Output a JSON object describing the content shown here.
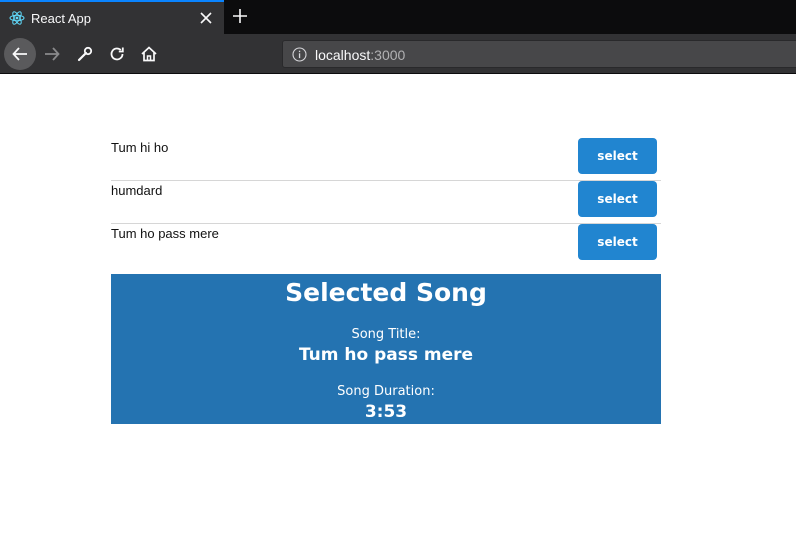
{
  "browser": {
    "tab_title": "React App",
    "url_host": "localhost",
    "url_port": ":3000"
  },
  "songs": [
    {
      "title": "Tum hi ho",
      "button_label": "select"
    },
    {
      "title": "humdard",
      "button_label": "select"
    },
    {
      "title": "Tum ho pass mere",
      "button_label": "select"
    }
  ],
  "selected": {
    "heading": "Selected Song",
    "title_label": "Song Title:",
    "title_value": "Tum ho pass mere",
    "duration_label": "Song Duration:",
    "duration_value": "3:53"
  },
  "colors": {
    "button": "#2185d0",
    "panel": "#2473b1",
    "tab_accent": "#0a84ff"
  },
  "icons": [
    "react-icon",
    "close-icon",
    "plus-icon",
    "back-arrow-icon",
    "forward-arrow-icon",
    "wrench-icon",
    "reload-icon",
    "home-icon",
    "info-icon"
  ]
}
